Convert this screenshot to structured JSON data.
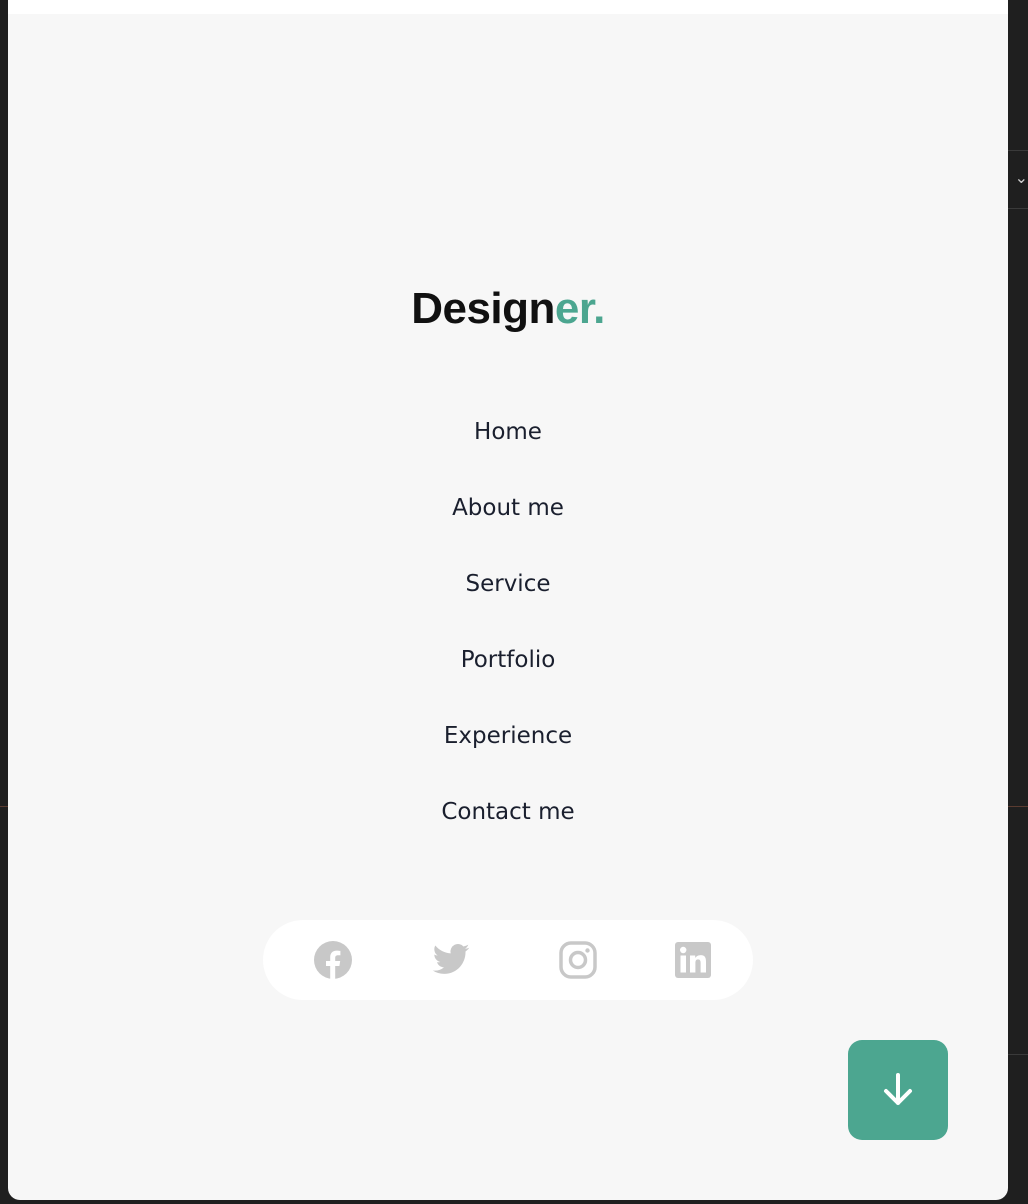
{
  "logo": {
    "main": "Design",
    "accent": "er."
  },
  "nav": {
    "items": [
      {
        "label": "Home"
      },
      {
        "label": "About me"
      },
      {
        "label": "Service"
      },
      {
        "label": "Portfolio"
      },
      {
        "label": "Experience"
      },
      {
        "label": "Contact me"
      }
    ]
  },
  "social": {
    "icons": [
      "facebook-icon",
      "twitter-icon",
      "instagram-icon",
      "linkedin-icon"
    ]
  },
  "scroll_button": {
    "icon": "arrow-down-icon"
  },
  "colors": {
    "accent": "#4ca690",
    "panel_bg": "#f7f7f7",
    "nav_text": "#1a1f2e",
    "icon_gray": "#c8c8c8"
  }
}
